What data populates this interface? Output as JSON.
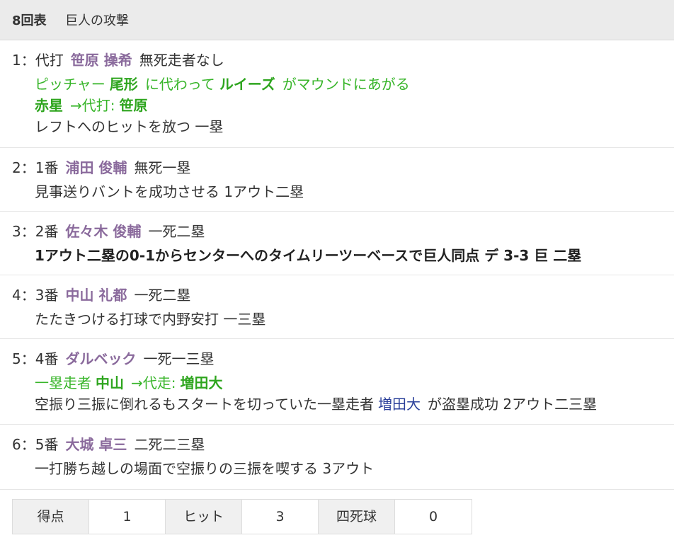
{
  "header": {
    "inning": "8回表",
    "title": "巨人の攻撃"
  },
  "plays": [
    {
      "num": "1：",
      "slot": "代打",
      "batter": "笹原 操希",
      "situation": "無死走者なし",
      "pitcher_change": {
        "prefix": "ピッチャー",
        "old": "尾形",
        "mid": "に代わって",
        "new": "ルイーズ",
        "suffix": "がマウンドにあがる"
      },
      "sub": {
        "out": "赤星",
        "arrow": "→代打:",
        "in": "笹原"
      },
      "result": "レフトへのヒットを放つ 一塁"
    },
    {
      "num": "2：",
      "slot": "1番",
      "batter": "浦田 俊輔",
      "situation": "無死一塁",
      "result": "見事送りバントを成功させる 1アウト二塁"
    },
    {
      "num": "3：",
      "slot": "2番",
      "batter": "佐々木 俊輔",
      "situation": "一死二塁",
      "result": "1アウト二塁の0-1からセンターへのタイムリーツーベースで巨人同点 デ 3-3 巨 二塁"
    },
    {
      "num": "4：",
      "slot": "3番",
      "batter": "中山 礼都",
      "situation": "一死二塁",
      "result": "たたきつける打球で内野安打 一三塁"
    },
    {
      "num": "5：",
      "slot": "4番",
      "batter": "ダルベック",
      "situation": "一死一三塁",
      "sub": {
        "prefix": "一塁走者",
        "out": "中山",
        "arrow": "→代走:",
        "in": "増田大"
      },
      "result_pre": "空振り三振に倒れるもスタートを切っていた一塁走者",
      "result_runner": "増田大",
      "result_post": "が盗塁成功 2アウト二三塁"
    },
    {
      "num": "6：",
      "slot": "5番",
      "batter": "大城 卓三",
      "situation": "二死二三塁",
      "result": "一打勝ち越しの場面で空振りの三振を喫する 3アウト"
    }
  ],
  "summary": [
    {
      "label": "得点",
      "value": "1"
    },
    {
      "label": "ヒット",
      "value": "3"
    },
    {
      "label": "四死球",
      "value": "0"
    }
  ]
}
